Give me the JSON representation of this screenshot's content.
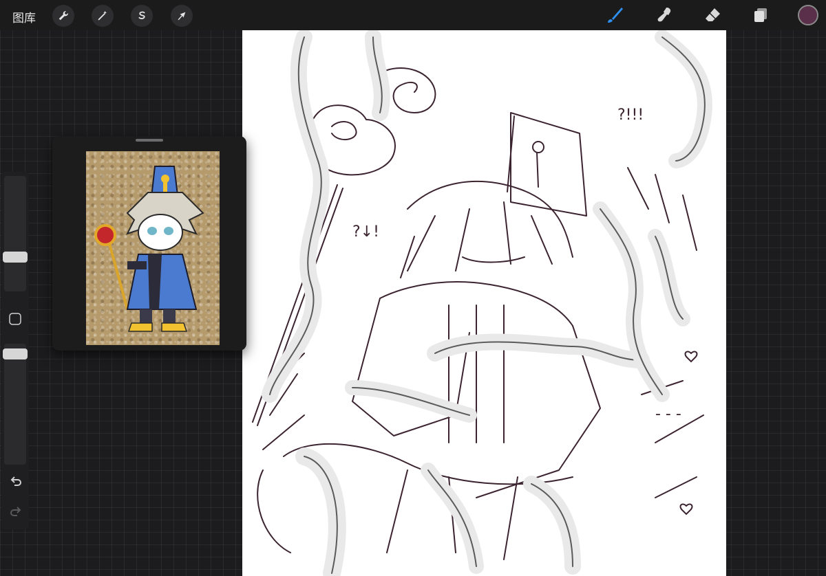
{
  "topbar": {
    "gallery_label": "图库",
    "tools_left": [
      {
        "name": "actions-wrench",
        "icon": "wrench-icon"
      },
      {
        "name": "adjustments-wand",
        "icon": "magic-wand-icon"
      },
      {
        "name": "selection",
        "icon": "selection-s-icon"
      },
      {
        "name": "transform",
        "icon": "arrow-cursor-icon"
      }
    ],
    "tools_right": [
      {
        "name": "brush",
        "icon": "brush-icon",
        "active": true
      },
      {
        "name": "smudge",
        "icon": "smudge-icon"
      },
      {
        "name": "eraser",
        "icon": "eraser-icon"
      },
      {
        "name": "layers",
        "icon": "layers-icon"
      }
    ],
    "current_color": "#5a2f4a",
    "active_color": "#2f8ff0"
  },
  "sidebar": {
    "brush_size_level": 0.7,
    "opacity_level": 0.95,
    "modifier_icon": "square-modifier-icon",
    "undo_icon": "undo-icon",
    "redo_icon": "redo-icon"
  },
  "reference": {
    "panel_icon": "grabber-handle-icon",
    "image": "chibi-character-reference"
  },
  "canvas": {
    "content": "line-sketch-drawing",
    "annotations": [
      "?!!!",
      "?↓!",
      "- - -"
    ]
  }
}
